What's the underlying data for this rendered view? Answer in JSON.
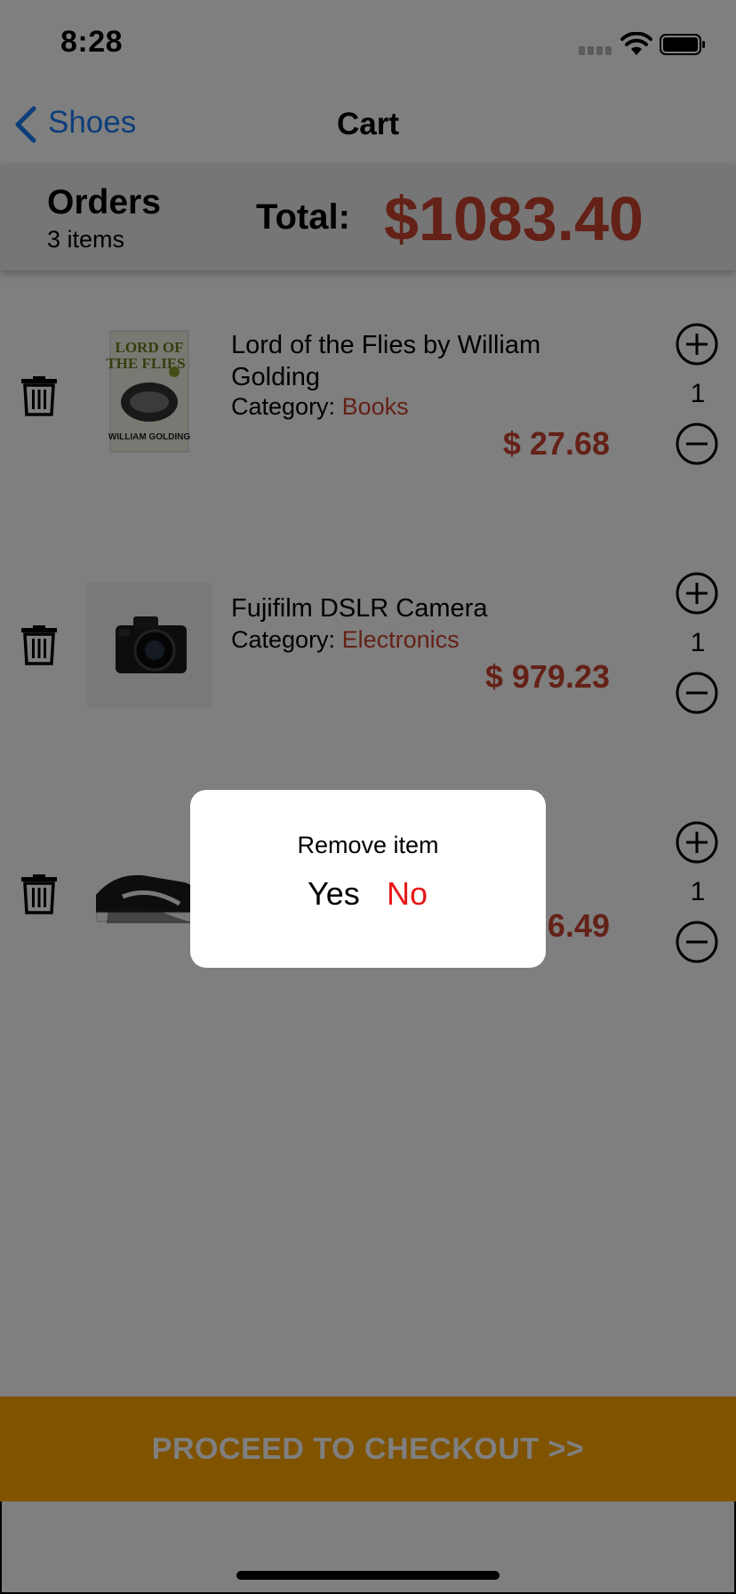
{
  "status_bar": {
    "time": "8:28"
  },
  "nav": {
    "back_label": "Shoes",
    "title": "Cart"
  },
  "orders": {
    "title": "Orders",
    "count": "3 items",
    "total_label": "Total:",
    "total_value": "$1083.40"
  },
  "items": [
    {
      "name": "Lord of the Flies by William Golding",
      "category_label": "Category:",
      "category": "Books",
      "price": "$ 27.68",
      "quantity": "1",
      "thumb_icon": "book-cover-image"
    },
    {
      "name": "Fujifilm DSLR Camera",
      "category_label": "Category:",
      "category": "Electronics",
      "price": "$ 979.23",
      "quantity": "1",
      "thumb_icon": "camera-image"
    },
    {
      "name": "",
      "category_label": "",
      "category": "",
      "price": "6.49",
      "quantity": "1",
      "thumb_icon": "sneaker-image"
    }
  ],
  "checkout": {
    "label": "PROCEED TO CHECKOUT  >>"
  },
  "dialog": {
    "message": "Remove item",
    "yes_label": "Yes",
    "no_label": "No"
  },
  "colors": {
    "accent": "#c8432f",
    "link": "#1a7cf5",
    "checkout": "#ffa700",
    "dialog_no": "#e81818"
  }
}
